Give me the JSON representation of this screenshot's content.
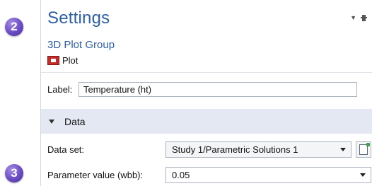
{
  "badges": {
    "step_a": "2",
    "step_b": "3"
  },
  "settings": {
    "title": "Settings",
    "subtitle": "3D Plot Group",
    "plot_button_label": "Plot",
    "label_field": {
      "label": "Label:",
      "value": "Temperature (ht)"
    },
    "data_section": {
      "title": "Data",
      "dataset": {
        "label": "Data set:",
        "value": "Study 1/Parametric Solutions 1"
      },
      "parameter": {
        "label": "Parameter value (wbb):",
        "value": "0.05"
      }
    }
  },
  "colors": {
    "accent": "#2d5fa8",
    "badge": "#6a4bc4",
    "section_bg": "#e3e8f2"
  },
  "icons": {
    "plot": "plot-icon",
    "dropdown": "chevron-down-icon",
    "pin": "pin-icon",
    "compute": "compute-icon"
  }
}
